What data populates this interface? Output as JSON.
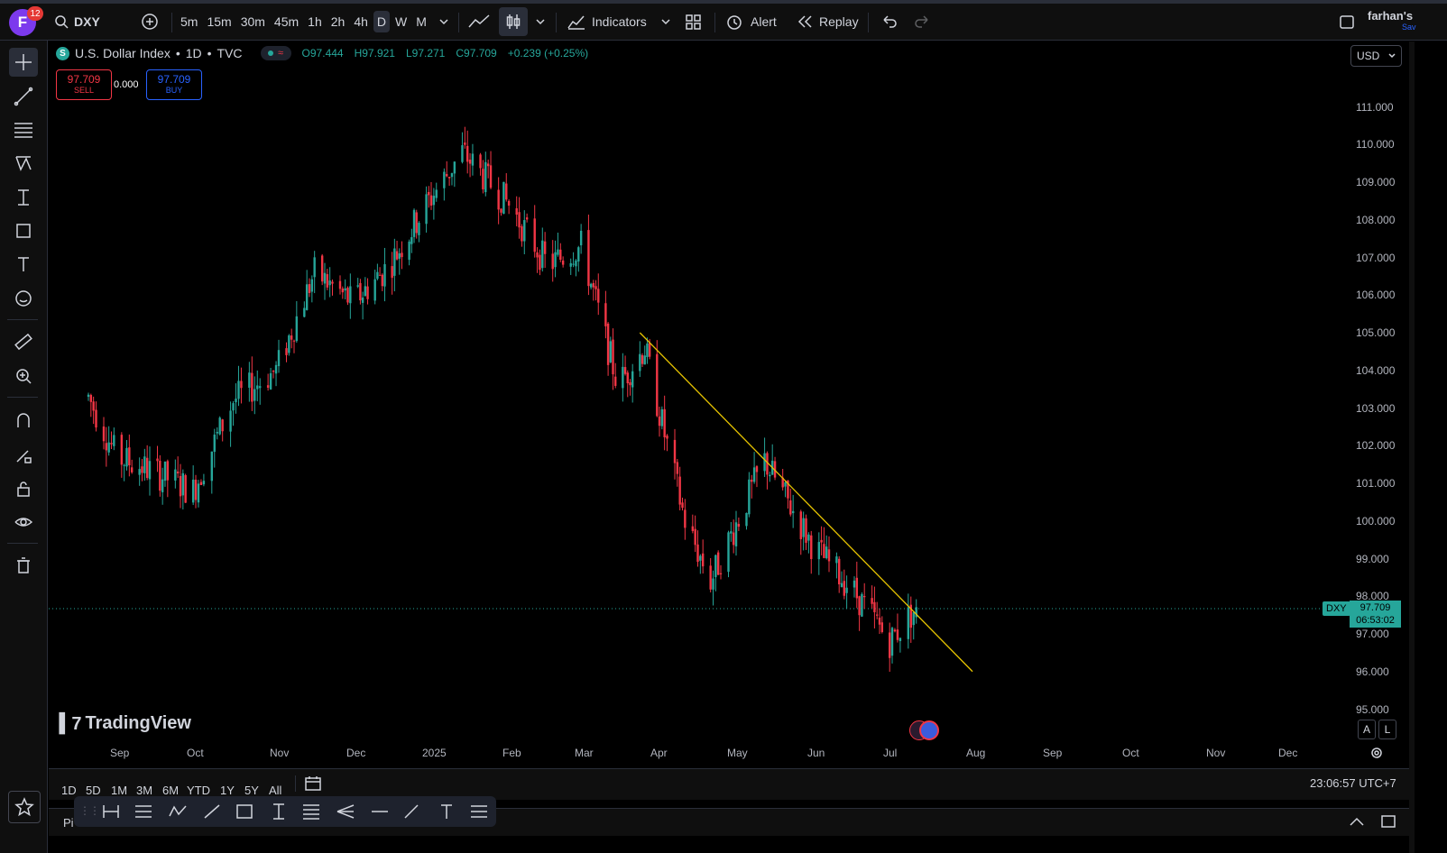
{
  "topbar": {
    "avatar_letter": "F",
    "notification_count": "12",
    "symbol": "DXY",
    "intervals": [
      "5m",
      "15m",
      "30m",
      "45m",
      "1h",
      "2h",
      "4h",
      "D",
      "W",
      "M"
    ],
    "active_interval": "D",
    "indicators_label": "Indicators",
    "alert_label": "Alert",
    "replay_label": "Replay",
    "account_name": "farhan's",
    "account_sub": "Sav"
  },
  "legend": {
    "badge": "S",
    "title": "U.S. Dollar Index",
    "timeframe": "1D",
    "source": "TVC",
    "open": "O97.444",
    "high": "H97.921",
    "low": "L97.271",
    "close": "C97.709",
    "change": "+0.239 (+0.25%)"
  },
  "trade": {
    "sell_price": "97.709",
    "sell_label": "SELL",
    "spread": "0.000",
    "buy_price": "97.709",
    "buy_label": "BUY"
  },
  "price_axis": {
    "currency": "USD",
    "labels": [
      "111.000",
      "110.000",
      "109.000",
      "108.000",
      "107.000",
      "106.000",
      "105.000",
      "104.000",
      "103.000",
      "102.000",
      "101.000",
      "100.000",
      "99.000",
      "98.000",
      "97.000",
      "96.000",
      "95.000"
    ],
    "symbol_tag": "DXY",
    "last_price": "97.709",
    "countdown": "06:53:02",
    "auto_label": "A",
    "log_label": "L"
  },
  "time_axis": {
    "labels": [
      "Sep",
      "Oct",
      "Nov",
      "Dec",
      "2025",
      "Feb",
      "Mar",
      "Apr",
      "May",
      "Jun",
      "Jul",
      "Aug",
      "Sep",
      "Oct",
      "Nov",
      "Dec"
    ]
  },
  "watermark": "TradingView",
  "ranges": [
    "1D",
    "5D",
    "1M",
    "3M",
    "6M",
    "YTD",
    "1Y",
    "5Y",
    "All"
  ],
  "clock": "23:06:57 UTC+7",
  "footer": {
    "tab_label": "Pi"
  },
  "chart_data": {
    "type": "candlestick",
    "symbol": "DXY",
    "interval": "1D",
    "ylim": [
      95,
      111.5
    ],
    "trendline": {
      "start": {
        "date": "2025-03-24",
        "price": 105.0
      },
      "end": {
        "date": "2025-07-31",
        "price": 96.0
      }
    },
    "monthly_path": [
      {
        "date": "2024-08-20",
        "price": 103.3
      },
      {
        "date": "2024-08-31",
        "price": 101.7
      },
      {
        "date": "2024-09-15",
        "price": 101.3
      },
      {
        "date": "2024-09-30",
        "price": 100.8
      },
      {
        "date": "2024-10-15",
        "price": 103.2
      },
      {
        "date": "2024-10-31",
        "price": 104.0
      },
      {
        "date": "2024-11-15",
        "price": 106.6
      },
      {
        "date": "2024-11-30",
        "price": 105.8
      },
      {
        "date": "2024-12-15",
        "price": 106.8
      },
      {
        "date": "2024-12-31",
        "price": 108.5
      },
      {
        "date": "2025-01-13",
        "price": 109.8
      },
      {
        "date": "2025-01-31",
        "price": 108.4
      },
      {
        "date": "2025-02-15",
        "price": 106.8
      },
      {
        "date": "2025-02-28",
        "price": 107.3
      },
      {
        "date": "2025-03-15",
        "price": 103.6
      },
      {
        "date": "2025-03-26",
        "price": 104.6
      },
      {
        "date": "2025-04-11",
        "price": 100.0
      },
      {
        "date": "2025-04-21",
        "price": 98.4
      },
      {
        "date": "2025-05-12",
        "price": 101.6
      },
      {
        "date": "2025-05-31",
        "price": 99.3
      },
      {
        "date": "2025-06-15",
        "price": 98.2
      },
      {
        "date": "2025-06-30",
        "price": 96.8
      },
      {
        "date": "2025-07-10",
        "price": 97.7
      }
    ],
    "last": {
      "open": 97.444,
      "high": 97.921,
      "low": 97.271,
      "close": 97.709
    }
  }
}
